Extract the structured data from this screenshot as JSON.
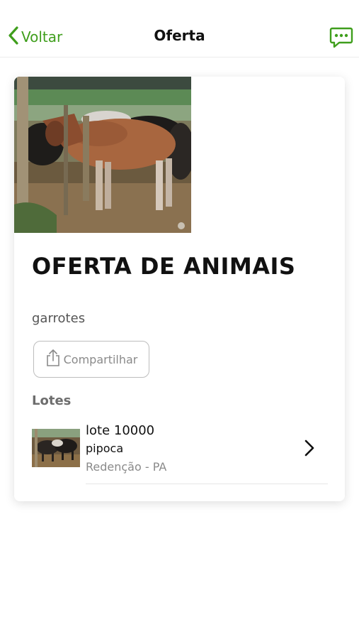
{
  "nav": {
    "back_label": "Voltar",
    "title": "Oferta",
    "back_icon": "chevron-left-icon",
    "chat_icon": "chat-bubble-icon",
    "accent_color": "#3f9e1c"
  },
  "offer": {
    "title": "OFERTA DE ANIMAIS",
    "description": "garrotes",
    "share_label": "Compartilhar",
    "share_icon": "share-icon"
  },
  "lots": {
    "section_title": "Lotes",
    "items": [
      {
        "name": "lote 10000",
        "seller": "pipoca",
        "location": "Redenção - PA"
      }
    ]
  }
}
